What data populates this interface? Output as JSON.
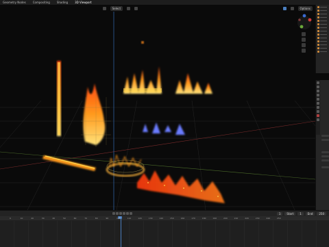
{
  "topbar": {
    "tabs": [
      {
        "label": "Geometry Nodes"
      },
      {
        "label": "Compositing"
      },
      {
        "label": "Shading"
      },
      {
        "label": "3D Viewport"
      }
    ]
  },
  "viewport_header": {
    "select_label": "Select",
    "view_label": "Options"
  },
  "timeline": {
    "current_frame": "1",
    "start_label": "Start",
    "start_value": "1",
    "end_label": "End",
    "end_value": "250",
    "ruler_ticks": [
      "0",
      "10",
      "20",
      "30",
      "40",
      "50",
      "60",
      "70",
      "80",
      "90",
      "100",
      "110",
      "120",
      "130",
      "140",
      "150",
      "160",
      "170",
      "180",
      "190",
      "200",
      "210",
      "220",
      "230",
      "240",
      "250"
    ]
  },
  "gizmo": {
    "x": "X",
    "y": "Y",
    "z": "Z"
  },
  "colors": {
    "fire_core": "#ffd24a",
    "fire_mid": "#ff8a1a",
    "fire_red": "#ff3a10",
    "blue_flame": "#6a7cff",
    "grid": "#2a2a2a",
    "accent": "#4a7ebf"
  }
}
